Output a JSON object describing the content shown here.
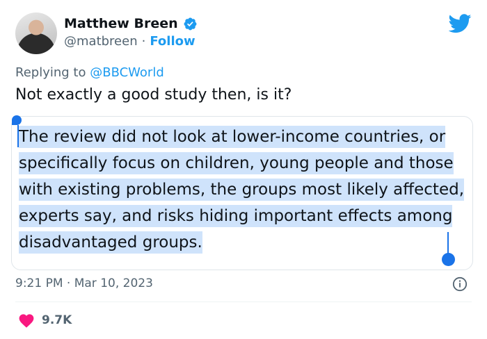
{
  "author": {
    "name": "Matthew Breen",
    "handle": "@matbreen",
    "separator": "·",
    "follow_label": "Follow"
  },
  "reply": {
    "prefix": "Replying to",
    "mention": "@BBCWorld"
  },
  "tweet": {
    "text": "Not exactly a good study then, is it?",
    "quoted_text": "The review did not look at lower-income countries, or specifically focus on children, young people and those with existing problems, the groups most likely affected, experts say, and risks hiding important effects among disadvantaged groups."
  },
  "meta": {
    "time": "9:21 PM",
    "separator": "·",
    "date": "Mar 10, 2023"
  },
  "engagement": {
    "likes": "9.7K"
  },
  "colors": {
    "brand_blue": "#1d9bf0",
    "selection": "#cfe3fb",
    "like_red": "#f91880"
  },
  "icons": {
    "verified": "verified-badge-icon",
    "brand": "twitter-bird-icon",
    "info": "info-icon",
    "like": "heart-icon"
  }
}
